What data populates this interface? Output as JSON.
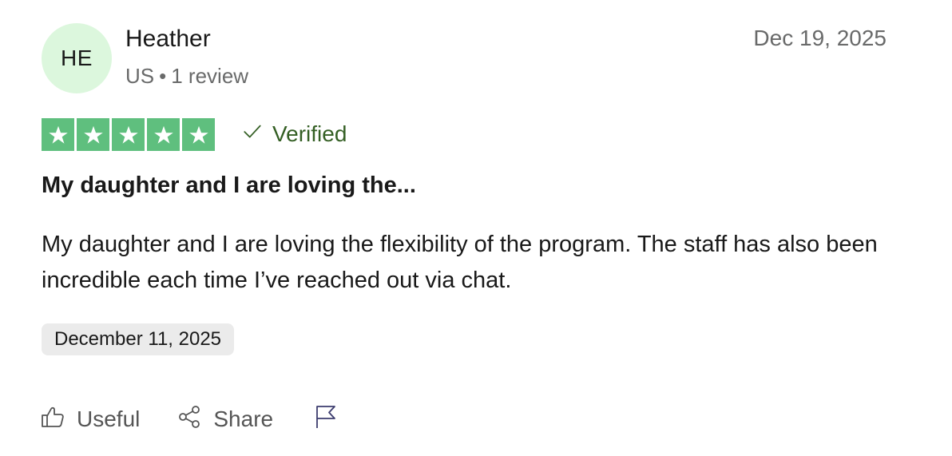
{
  "consumer": {
    "initials": "HE",
    "name": "Heather",
    "country": "US",
    "separator": "•",
    "review_count": "1 review"
  },
  "review": {
    "published_date": "Dec 19, 2025",
    "rating": 5,
    "rating_max": 5,
    "verified_label": "Verified",
    "title": "My daughter and I are loving the...",
    "body": "My daughter and I are loving the flexibility of the program. The staff has also been incredible each time I’ve reached out via chat.",
    "experience_date": "December 11, 2025"
  },
  "actions": {
    "useful_label": "Useful",
    "share_label": "Share",
    "report_icon": "flag-icon",
    "useful_icon": "thumbs-up-icon",
    "share_icon": "share-icon"
  },
  "colors": {
    "star_green": "#5fbf7e",
    "avatar_bg": "#dcf7dd",
    "verified_text": "#345f24",
    "muted_text": "#696a6a"
  }
}
